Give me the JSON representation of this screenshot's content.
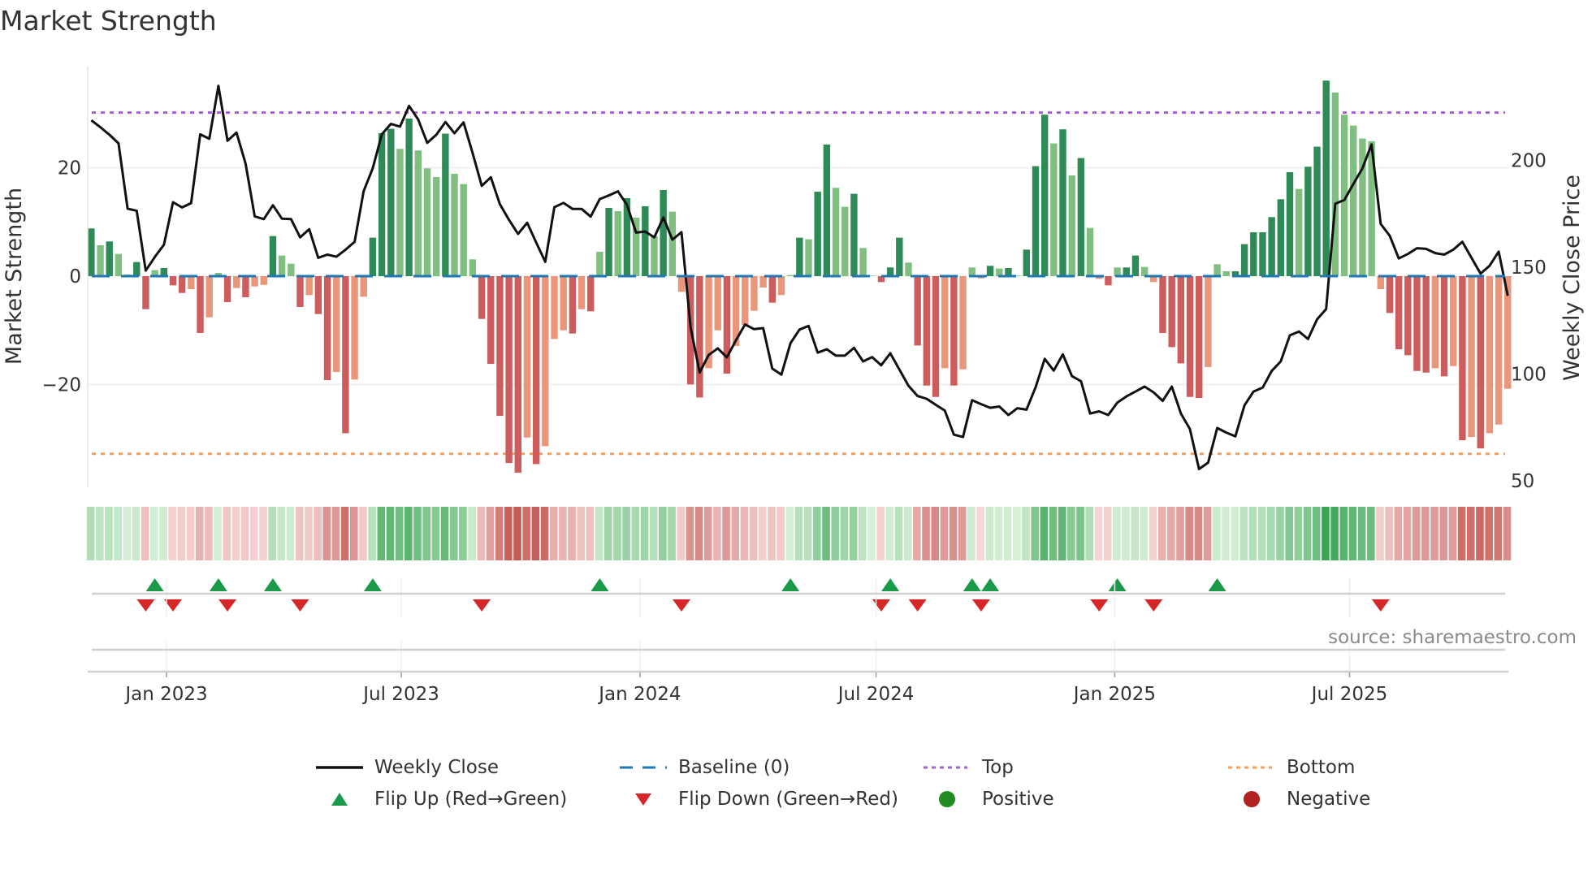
{
  "title": "Market Strength",
  "source": "source: sharemaestro.com",
  "colors": {
    "pos_dark": "#2e8b57",
    "pos_light": "#80bf80",
    "neg_dark": "#cd5c5c",
    "neg_light": "#e9967a",
    "price": "#111111",
    "baseline": "#1f77b4",
    "top": "#a45ee0",
    "bottom": "#f0a060",
    "flip_up": "#1a9a48",
    "flip_down": "#d62728",
    "positive": "#228b22",
    "negative": "#b22222"
  },
  "legend": [
    {
      "label": "Weekly Close",
      "symbol": "line-solid",
      "color": "#111111"
    },
    {
      "label": "Baseline (0)",
      "symbol": "line-dashed",
      "color": "#1f77b4"
    },
    {
      "label": "Top",
      "symbol": "line-dotted",
      "color": "#a45ee0"
    },
    {
      "label": "Bottom",
      "symbol": "line-dotted",
      "color": "#f0a060"
    },
    {
      "label": "Flip Up (Red→Green)",
      "symbol": "triangle-up",
      "color": "#1a9a48"
    },
    {
      "label": "Flip Down (Green→Red)",
      "symbol": "triangle-down",
      "color": "#d62728"
    },
    {
      "label": "Positive",
      "symbol": "circle",
      "color": "#228b22"
    },
    {
      "label": "Negative",
      "symbol": "circle",
      "color": "#b22222"
    }
  ],
  "chart_data": {
    "type": "bar",
    "title": "Market Strength",
    "ylabel": "Market Strength",
    "y2label": "Weekly Close Price",
    "start_date": "2022-11-04",
    "frequency": "weekly",
    "y_ticks": [
      {
        "value": 20,
        "label": "20"
      },
      {
        "value": 0,
        "label": "0"
      },
      {
        "value": -20,
        "label": "−20"
      }
    ],
    "y2_ticks": [
      {
        "value": 200,
        "label": "200"
      },
      {
        "value": 150,
        "label": "150"
      },
      {
        "value": 100,
        "label": "100"
      },
      {
        "value": 50,
        "label": "50"
      }
    ],
    "x_ticks": [
      {
        "date": "2023-01-01",
        "label": "Jan 2023"
      },
      {
        "date": "2023-07-01",
        "label": "Jul 2023"
      },
      {
        "date": "2024-01-01",
        "label": "Jan 2024"
      },
      {
        "date": "2024-07-01",
        "label": "Jul 2024"
      },
      {
        "date": "2025-01-01",
        "label": "Jan 2025"
      },
      {
        "date": "2025-07-01",
        "label": "Jul 2025"
      }
    ],
    "top_level": 30.2,
    "bottom_level": -32.8,
    "baseline": 0,
    "strength": [
      8.8,
      5.7,
      6.4,
      4.1,
      0.3,
      2.6,
      -6.1,
      1.1,
      1.5,
      -1.7,
      -3.1,
      -2.4,
      -10.5,
      -7.6,
      0.6,
      -4.8,
      -2.2,
      -3.9,
      -1.9,
      -1.6,
      7.4,
      3.8,
      2.3,
      -5.7,
      -3.5,
      -7.0,
      -19.2,
      -17.7,
      -29.0,
      -19.1,
      -3.8,
      7.1,
      26.4,
      27.2,
      23.5,
      29.1,
      23.2,
      19.9,
      18.3,
      26.3,
      18.9,
      17.0,
      3.1,
      -7.9,
      -16.2,
      -25.8,
      -34.5,
      -36.3,
      -29.8,
      -34.7,
      -31.4,
      -11.6,
      -10.0,
      -10.6,
      -6.1,
      -6.5,
      4.5,
      12.6,
      12.0,
      14.4,
      10.8,
      12.9,
      7.4,
      15.9,
      11.9,
      -2.9,
      -20.0,
      -22.4,
      -17.0,
      -10.0,
      -18.0,
      -12.9,
      -9.0,
      -6.4,
      -2.1,
      -4.9,
      -3.5,
      0.2,
      7.1,
      6.8,
      15.6,
      24.3,
      16.3,
      12.8,
      15.2,
      5.2,
      0.1,
      -1.1,
      1.6,
      7.1,
      2.5,
      -12.8,
      -20.2,
      -22.3,
      -17.0,
      -20.2,
      -17.2,
      1.6,
      -0.4,
      1.9,
      1.4,
      1.5,
      0.1,
      4.9,
      20.3,
      29.8,
      24.5,
      27.1,
      18.6,
      21.8,
      8.9,
      -0.5,
      -1.7,
      1.6,
      1.6,
      3.8,
      1.7,
      -1.1,
      -10.5,
      -13.1,
      -16.1,
      -22.3,
      -22.5,
      -16.8,
      2.2,
      0.9,
      0.9,
      5.9,
      8.1,
      8.1,
      10.9,
      14.2,
      19.2,
      16.1,
      20.2,
      23.9,
      36.1,
      33.9,
      29.8,
      27.8,
      25.4,
      24.9,
      -2.4,
      -6.8,
      -13.5,
      -14.6,
      -17.5,
      -17.8,
      -17.0,
      -18.5,
      -16.6,
      -30.3,
      -29.7,
      -31.8,
      -29.0,
      -27.4,
      -20.8
    ],
    "weekly_close": [
      218.8,
      215.5,
      212.0,
      208.0,
      177.4,
      176.4,
      148.4,
      154.8,
      160.5,
      180.4,
      178.0,
      180.0,
      212.2,
      210.1,
      234.9,
      209.2,
      213.0,
      198.4,
      173.8,
      172.5,
      179.0,
      172.7,
      172.5,
      164.0,
      167.8,
      154.4,
      155.9,
      154.9,
      158.2,
      161.9,
      185.6,
      196.3,
      212.2,
      217.1,
      215.8,
      225.5,
      219.2,
      208.2,
      212.0,
      218.0,
      212.7,
      217.8,
      203.4,
      188.1,
      192.1,
      179.5,
      172.2,
      165.6,
      170.8,
      161.6,
      152.5,
      178.1,
      180.1,
      177.3,
      177.3,
      173.7,
      181.9,
      183.6,
      185.5,
      179.2,
      166.2,
      166.7,
      164.0,
      173.3,
      162.9,
      166.4,
      121.9,
      100.7,
      108.9,
      112.0,
      107.8,
      115.8,
      123.2,
      121.0,
      121.5,
      102.5,
      99.7,
      114.4,
      120.8,
      122.5,
      110.0,
      111.6,
      108.6,
      108.6,
      112.3,
      105.9,
      107.9,
      104.1,
      109.7,
      102.1,
      94.5,
      89.7,
      88.4,
      85.6,
      82.9,
      71.6,
      70.5,
      87.7,
      85.9,
      84.2,
      84.8,
      80.8,
      84.0,
      83.3,
      93.8,
      107.1,
      101.6,
      109.2,
      99.0,
      96.6,
      81.5,
      82.5,
      80.8,
      86.6,
      89.5,
      91.8,
      94.1,
      91.4,
      87.4,
      94.1,
      81.5,
      74.2,
      55.5,
      58.5,
      74.7,
      72.6,
      70.8,
      85.3,
      91.8,
      93.6,
      101.4,
      105.9,
      118.1,
      119.9,
      116.4,
      125.6,
      130.4,
      179.7,
      181.5,
      189.0,
      196.3,
      207.5,
      170.3,
      164.7,
      154.1,
      156.2,
      158.9,
      158.6,
      156.6,
      155.9,
      158.2,
      161.9,
      154.4,
      147.0,
      150.7,
      157.3,
      136.6
    ]
  }
}
